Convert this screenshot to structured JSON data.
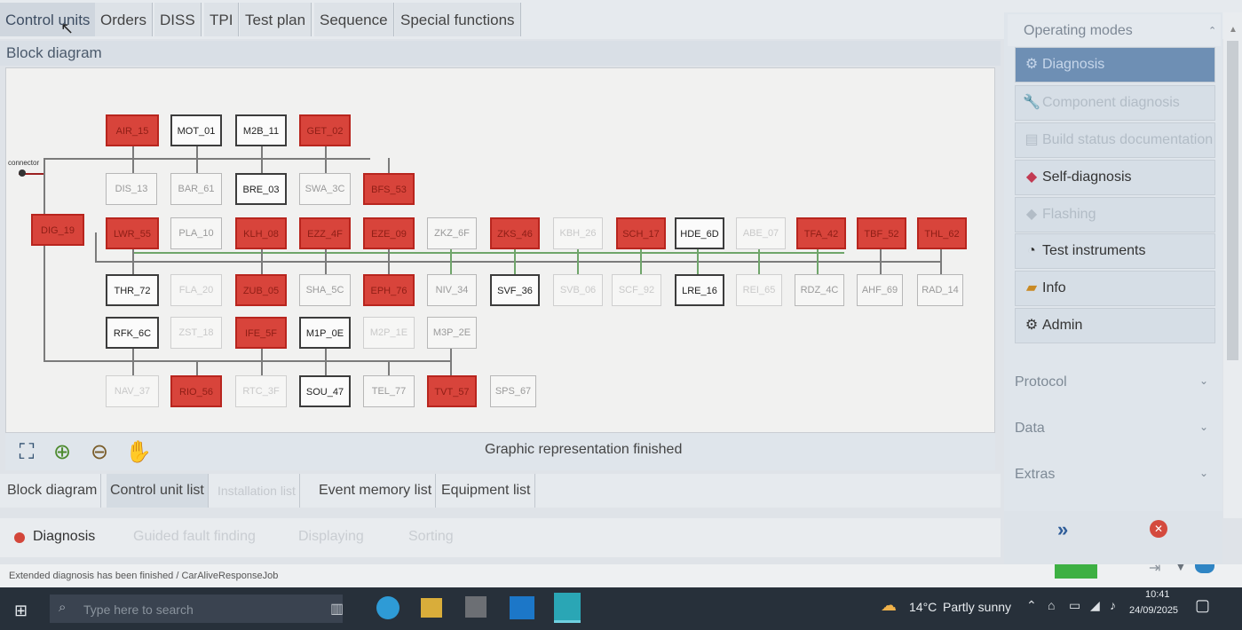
{
  "tabs_top": [
    "Control units",
    "Orders",
    "DISS",
    "TPI",
    "Test plan",
    "Sequence",
    "Special functions"
  ],
  "panel_title": "Block diagram",
  "connector_label": "connector",
  "blocks": {
    "AIR": "AIR_15",
    "MOT": "MOT_01",
    "M2B": "M2B_11",
    "GET": "GET_02",
    "DIS": "DIS_13",
    "BAR": "BAR_61",
    "BRE": "BRE_03",
    "SWA": "SWA_3C",
    "BFS": "BFS_53",
    "DIG": "DIG_19",
    "LWR": "LWR_55",
    "PLA": "PLA_10",
    "KLH": "KLH_08",
    "EZZ": "EZZ_4F",
    "EZE": "EZE_09",
    "ZKZ": "ZKZ_6F",
    "ZKS": "ZKS_46",
    "KBH": "KBH_26",
    "SCH": "SCH_17",
    "HDE": "HDE_6D",
    "ABE": "ABE_07",
    "TFA": "TFA_42",
    "TBF": "TBF_52",
    "THL": "THL_62",
    "THR": "THR_72",
    "FLA": "FLA_20",
    "ZUB": "ZUB_05",
    "SHA": "SHA_5C",
    "EPH": "EPH_76",
    "NIV": "NIV_34",
    "SVF": "SVF_36",
    "SVB": "SVB_06",
    "SCF": "SCF_92",
    "LRE": "LRE_16",
    "REI": "REI_65",
    "RDZ": "RDZ_4C",
    "AHF": "AHF_69",
    "RAD": "RAD_14",
    "RFK": "RFK_6C",
    "ZST": "ZST_18",
    "IFE": "IFE_5F",
    "M1P": "M1P_0E",
    "M2P": "M2P_1E",
    "M3P": "M3P_2E",
    "NAV": "NAV_37",
    "RIO": "RIO_56",
    "RTC": "RTC_3F",
    "SOU": "SOU_47",
    "TEL": "TEL_77",
    "TVT": "TVT_57",
    "SPS": "SPS_67"
  },
  "graphic_status": "Graphic representation finished",
  "tabs_bottom": [
    "Block diagram",
    "Control unit list",
    "Installation list",
    "Event memory list",
    "Equipment list"
  ],
  "modes": [
    "Diagnosis",
    "Guided fault finding",
    "Displaying",
    "Sorting"
  ],
  "status_message": "Extended diagnosis has been finished  / CarAliveResponseJob",
  "right_panel": {
    "header": "Operating modes",
    "items": [
      "Diagnosis",
      "Component diagnosis",
      "Build status documentation",
      "Self-diagnosis",
      "Flashing",
      "Test instruments",
      "Info",
      "Admin"
    ],
    "sections": [
      "Protocol",
      "Data",
      "Extras"
    ]
  },
  "taskbar": {
    "search_placeholder": "Type here to search",
    "temperature": "14°C",
    "weather": "Partly sunny",
    "time": "10:41",
    "date": "24/09/2025"
  },
  "colors": {
    "error": "#d8443b",
    "selected": "#6e8fb4",
    "bus_green": "#6fa56a"
  }
}
